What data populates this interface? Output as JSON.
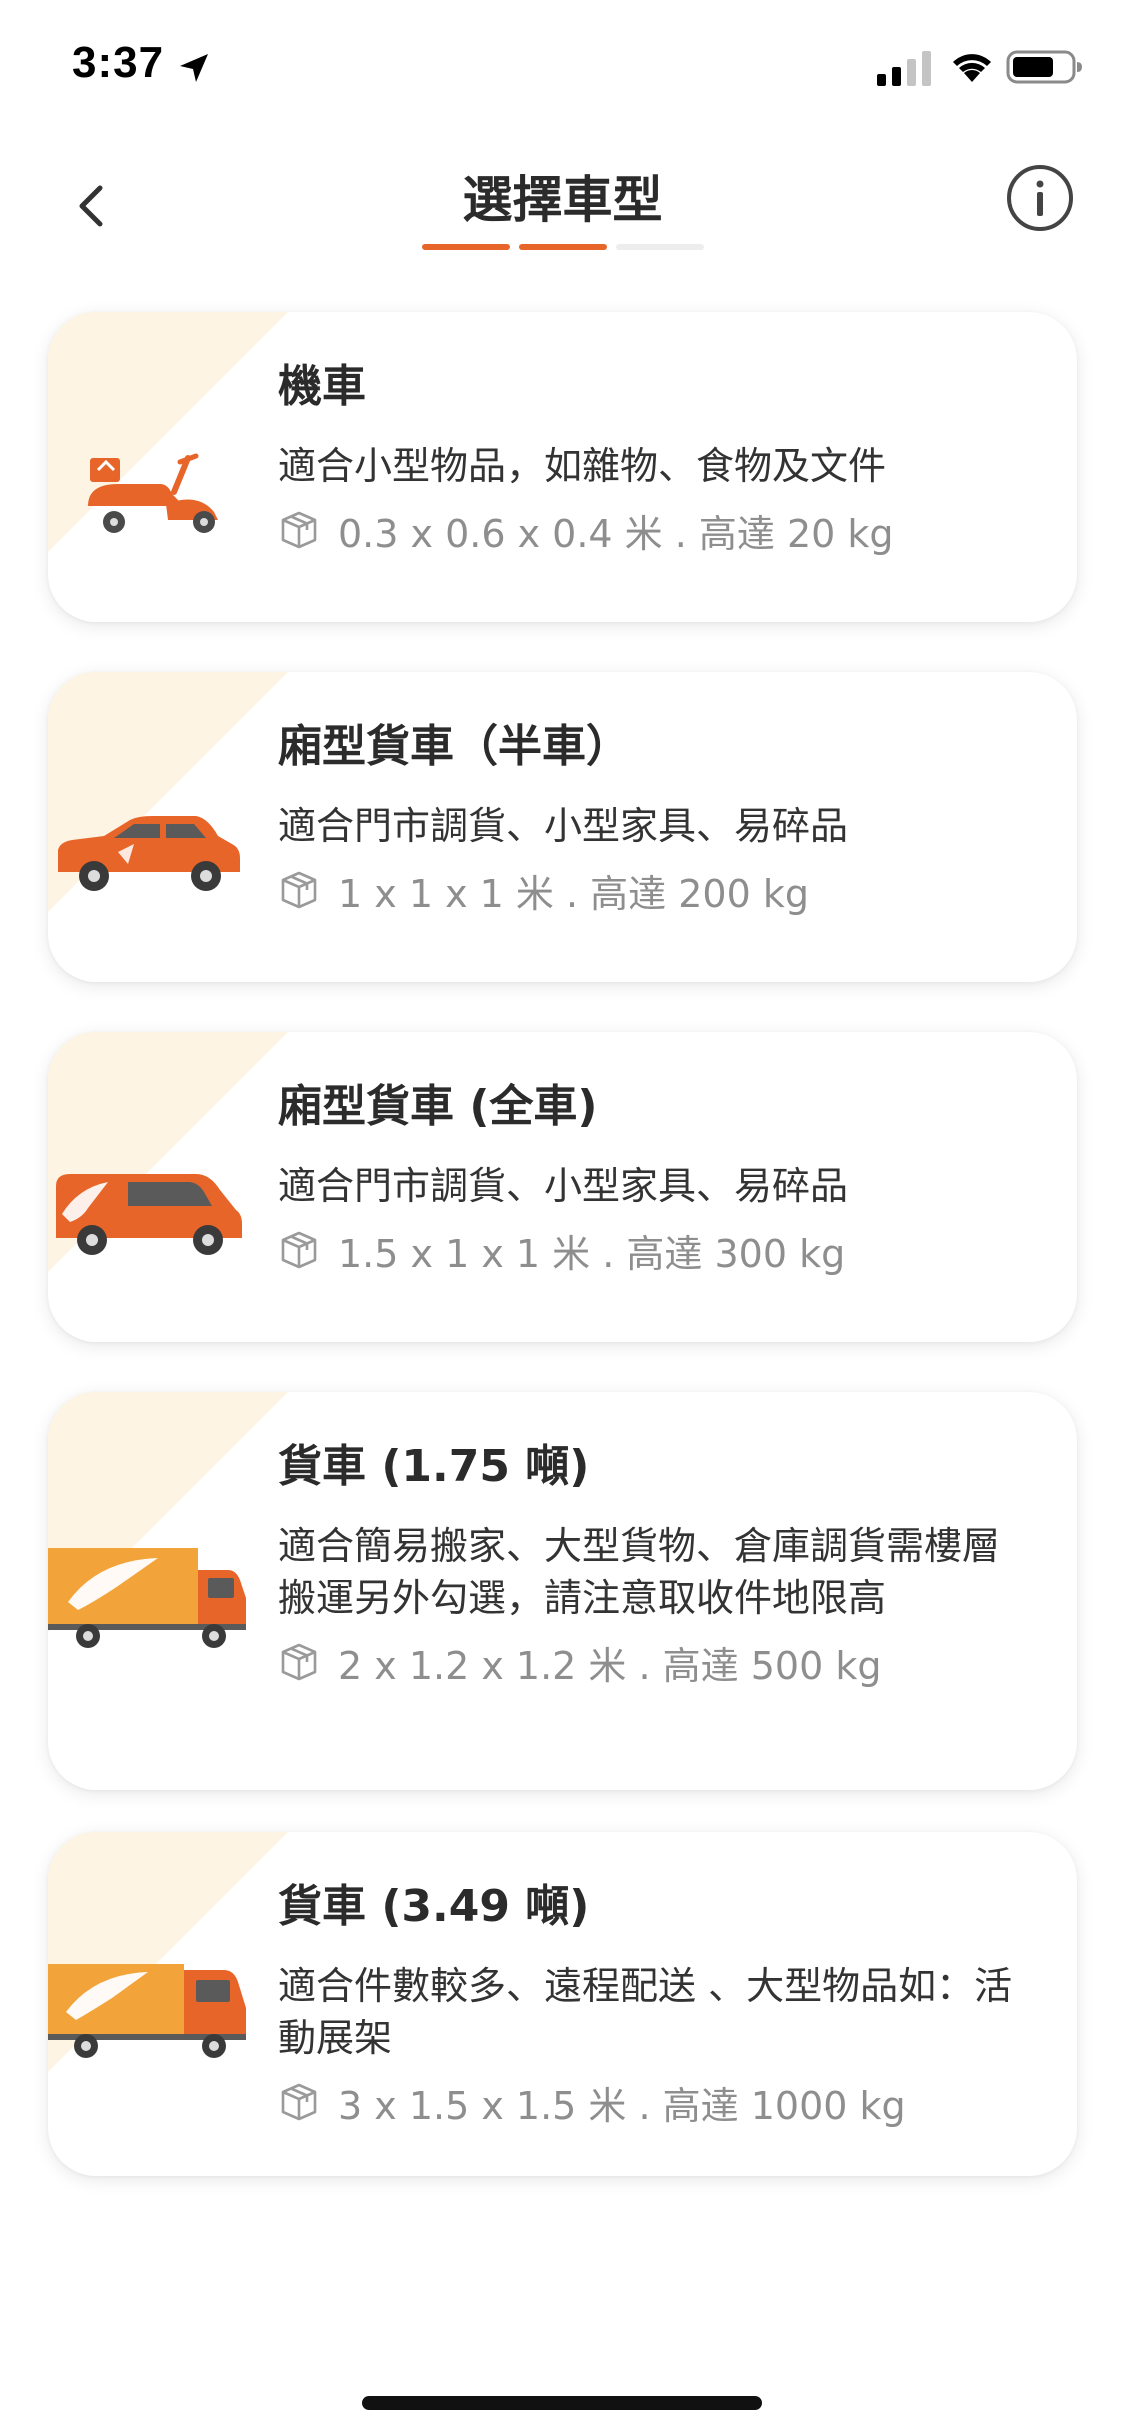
{
  "status_bar": {
    "time": "3:37"
  },
  "header": {
    "title": "選擇車型",
    "steps_total": 3,
    "steps_completed": 2
  },
  "colors": {
    "accent": "#E8652A",
    "accent_light": "#FDF4E4",
    "truck_yellow": "#F2A33A",
    "step_inactive": "#EDEDED"
  },
  "vehicles": [
    {
      "name": "機車",
      "description": "適合小型物品，如雜物、食物及文件",
      "spec": "0.3 x 0.6 x 0.4 米 . 高達 20 kg",
      "icon": "scooter-icon"
    },
    {
      "name": "廂型貨車（半車）",
      "description": "適合門市調貨、小型家具、易碎品",
      "spec": "1 x 1 x 1 米 . 高達 200 kg",
      "icon": "suv-icon"
    },
    {
      "name": "廂型貨車 (全車)",
      "description": "適合門市調貨、小型家具、易碎品",
      "spec": "1.5 x 1 x 1 米 . 高達 300 kg",
      "icon": "van-icon"
    },
    {
      "name": "貨車 (1.75 噸)",
      "description": "適合簡易搬家、大型貨物、倉庫調貨需樓層搬運另外勾選，請注意取收件地限高",
      "spec": "2 x 1.2 x 1.2 米 . 高達 500 kg",
      "icon": "truck-icon"
    },
    {
      "name": "貨車 (3.49 噸)",
      "description": "適合件數較多、遠程配送 、大型物品如：活動展架",
      "spec": "3 x 1.5 x 1.5 米 . 高達 1000 kg",
      "icon": "large-truck-icon"
    }
  ]
}
